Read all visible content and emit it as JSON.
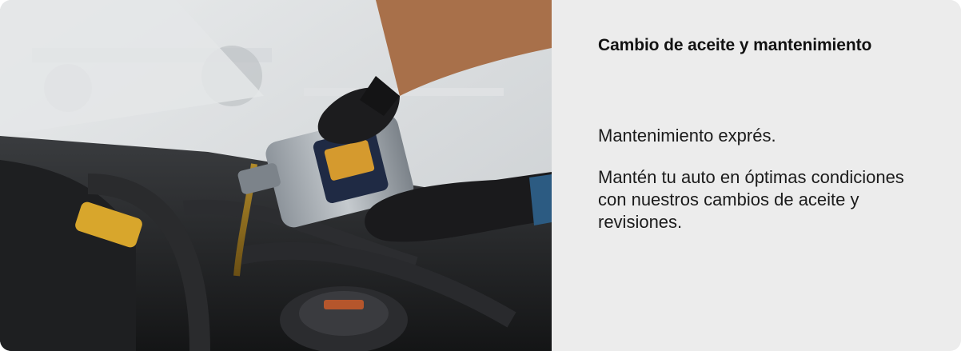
{
  "card": {
    "image_alt": "Mecánico vertiendo aceite en el motor de un auto",
    "title": "Cambio de aceite y mantenimiento",
    "subtitle": "Mantenimiento exprés.",
    "description": "Mantén tu auto en óptimas condiciones con nuestros cambios de aceite y revisiones."
  },
  "colors": {
    "panel_background": "#ececec",
    "text": "#1b1b1b"
  }
}
